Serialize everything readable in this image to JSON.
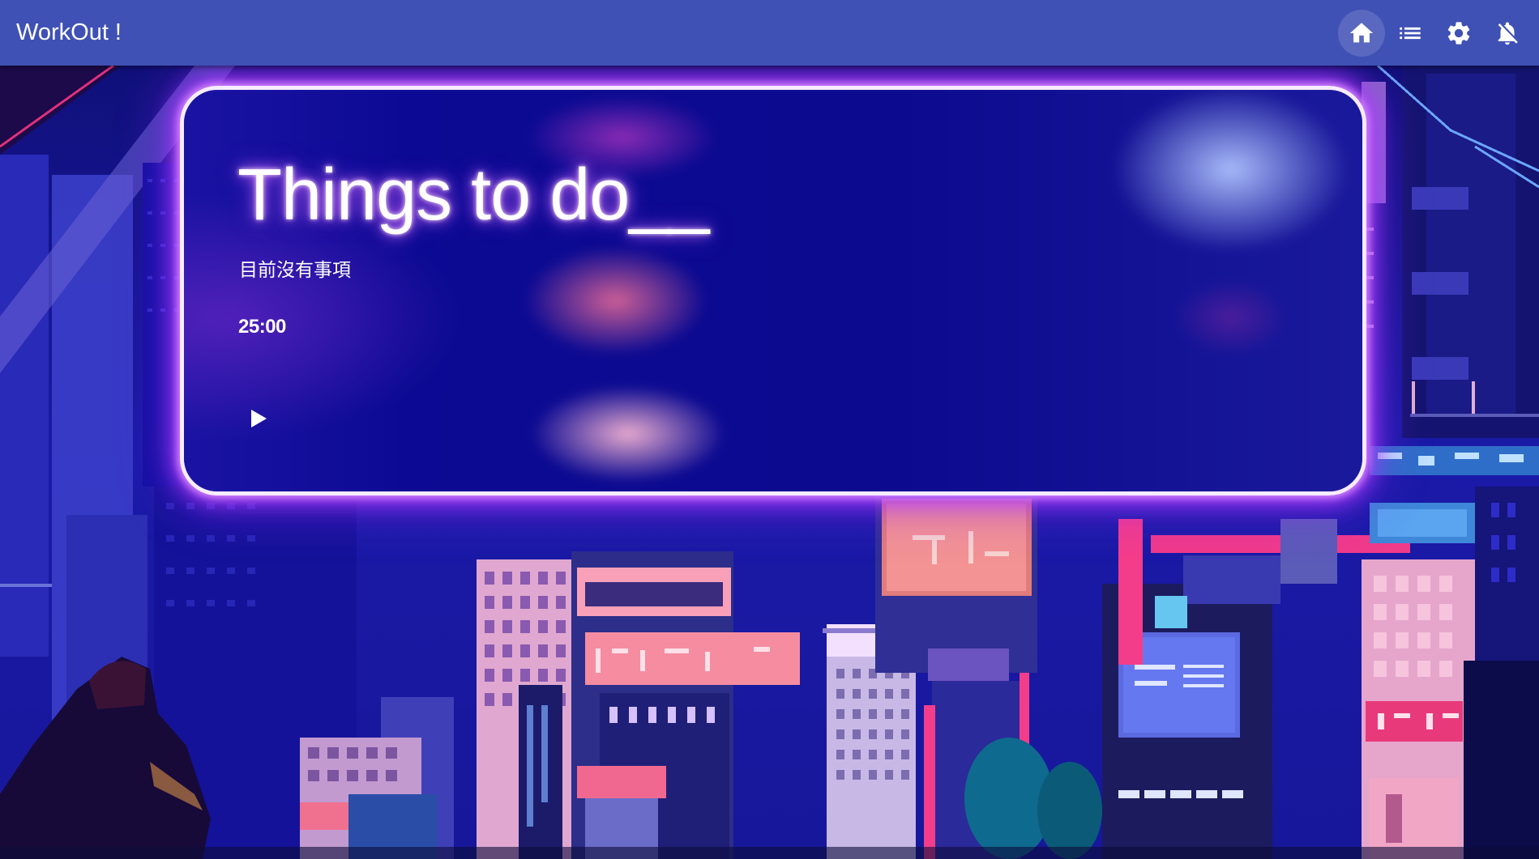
{
  "appbar": {
    "title": "WorkOut !",
    "actions": [
      {
        "name": "home",
        "icon": "home-icon",
        "active": true
      },
      {
        "name": "list",
        "icon": "list-icon",
        "active": false
      },
      {
        "name": "settings",
        "icon": "gear-icon",
        "active": false
      },
      {
        "name": "notifications",
        "icon": "bell-off-icon",
        "active": false
      }
    ]
  },
  "card": {
    "title": "Things to do__",
    "status": "目前沒有事項",
    "timer": "25:00",
    "play_icon": "play-icon"
  },
  "background": {
    "description_icon": "pixel-city-night-background"
  },
  "colors": {
    "appbar": "#3f51b5",
    "glow": "#b03cff",
    "card_border": "#f7ecff",
    "text": "#ffffff"
  }
}
